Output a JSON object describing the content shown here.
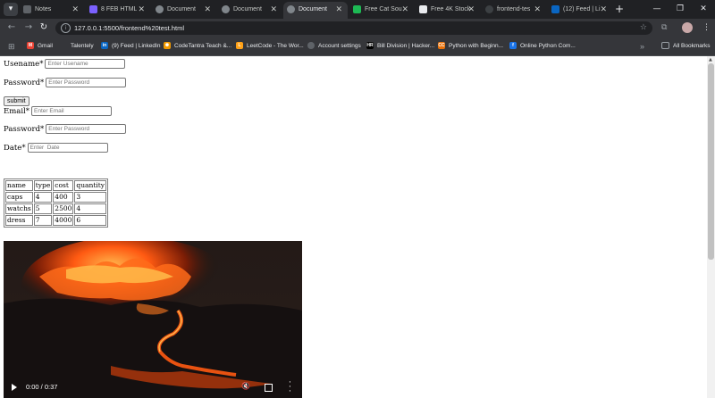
{
  "tabs": [
    {
      "title": "Notes",
      "icon_color": "#5f6368",
      "active": false
    },
    {
      "title": "8 FEB HTML",
      "icon_color": "#7b61ff",
      "active": false
    },
    {
      "title": "Document",
      "icon_color": "#80868b",
      "active": false
    },
    {
      "title": "Document",
      "icon_color": "#80868b",
      "active": false
    },
    {
      "title": "Document",
      "icon_color": "#80868b",
      "active": true
    },
    {
      "title": "Free Cat Sou",
      "icon_color": "#1db954",
      "active": false
    },
    {
      "title": "Free 4K Stock",
      "icon_color": "#e8eaed",
      "active": false
    },
    {
      "title": "frontend-tes",
      "icon_color": "#3c4043",
      "active": false
    },
    {
      "title": "(12) Feed | Li",
      "icon_color": "#0a66c2",
      "active": false
    }
  ],
  "address_bar": {
    "url": "127.0.0.1:5500/frontend%20test.html"
  },
  "bookmarks": [
    {
      "label": "Gmail",
      "icon_color": "#ea4335",
      "icon_text": "M"
    },
    {
      "label": "Talentely",
      "icon_color": "#35363a",
      "icon_text": ""
    },
    {
      "label": "(9) Feed | LinkedIn",
      "icon_color": "#0a66c2",
      "icon_text": "in"
    },
    {
      "label": "CodeTantra Teach &...",
      "icon_color": "#f29900",
      "icon_text": "✺"
    },
    {
      "label": "LeetCode - The Wor...",
      "icon_color": "#ffa116",
      "icon_text": "L"
    },
    {
      "label": "Account settings",
      "icon_color": "#5f6368",
      "icon_text": "●"
    },
    {
      "label": "Bill Division | Hacker...",
      "icon_color": "#000000",
      "icon_text": "HR"
    },
    {
      "label": "Python with Beginn...",
      "icon_color": "#e8710a",
      "icon_text": "CC"
    },
    {
      "label": "Online Python Com...",
      "icon_color": "#1a73e8",
      "icon_text": "f"
    }
  ],
  "all_bookmarks_label": "All Bookmarks",
  "form1": {
    "username_label": "Usename*",
    "username_placeholder": "Enter Usename",
    "password_label": "Password*",
    "password_placeholder": "Enter Password",
    "submit_label": "submit"
  },
  "form2": {
    "email_label": "Email*",
    "email_placeholder": "Enter Email",
    "password_label": "Password*",
    "password_placeholder": "Enter Password",
    "date_label": "Date*",
    "date_placeholder": "Enter  Date"
  },
  "table": {
    "headers": [
      "name",
      "type",
      "cost",
      "quantity"
    ],
    "rows": [
      [
        "caps",
        "4",
        "400",
        "3"
      ],
      [
        "watchs",
        "5",
        "2500",
        "4"
      ],
      [
        "dress",
        "7",
        "4000",
        "6"
      ]
    ]
  },
  "video": {
    "time": "0:00 / 0:37"
  }
}
